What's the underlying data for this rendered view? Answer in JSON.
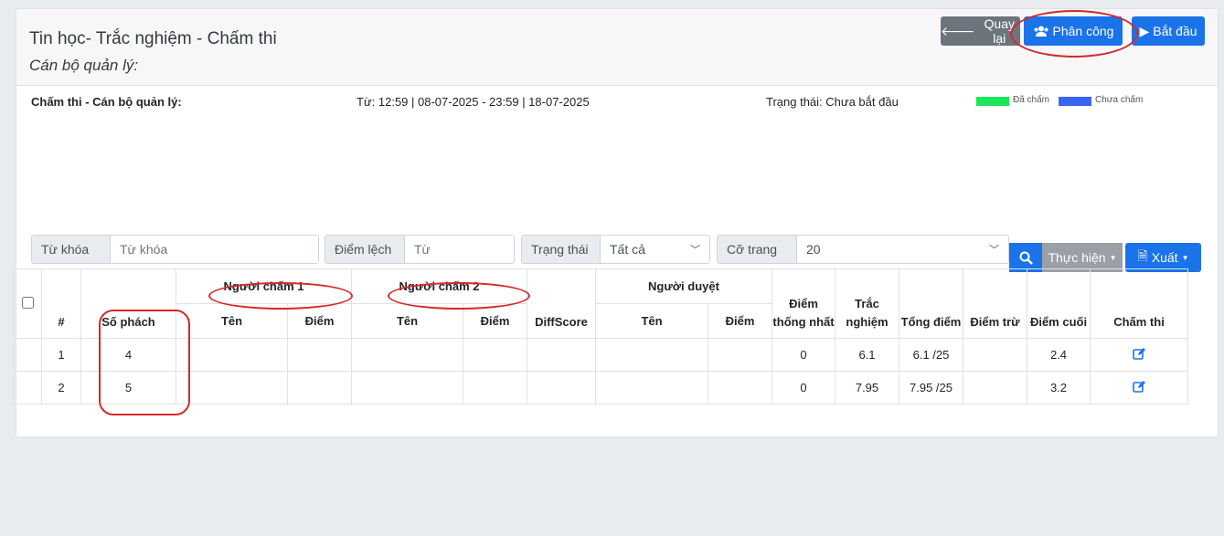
{
  "header": {
    "title": "Tin học- Trắc nghiệm - Chấm thi",
    "subtitle": "Cán bộ quản lý:",
    "back_label": "Quay lại",
    "assign_label": "Phân công",
    "start_label": "Bắt đầu"
  },
  "info": {
    "role_label": "Chấm thi - Cán bộ quản lý:",
    "time_range": "Từ: 12:59 | 08-07-2025 - 23:59 | 18-07-2025",
    "status": "Trạng thái: Chưa bắt đầu",
    "legend": [
      {
        "label": "Đã chấm",
        "color": "#1de55a"
      },
      {
        "label": "Chưa chấm",
        "color": "#3a63f0"
      }
    ]
  },
  "filters": {
    "keyword_label": "Từ khóa",
    "keyword_placeholder": "Từ khóa",
    "deviation_label": "Điểm lệch",
    "deviation_placeholder": "Từ",
    "status_label": "Trạng thái",
    "status_value": "Tất cả",
    "pagesize_label": "Cỡ trang",
    "pagesize_value": "20",
    "action_label": "Thực hiện",
    "export_label": "Xuất"
  },
  "table": {
    "headers": {
      "index": "#",
      "so_phach": "Số phách",
      "grader1": "Người chấm 1",
      "grader2": "Người chấm 2",
      "diffscore": "DiffScore",
      "approver": "Người duyệt",
      "name": "Tên",
      "score": "Điểm",
      "unified": "Điểm thống nhất",
      "mcq": "Trắc nghiệm",
      "total": "Tổng điểm",
      "deduct": "Điểm trừ",
      "final": "Điểm cuối",
      "grade": "Chấm thi"
    },
    "rows": [
      {
        "index": "1",
        "so_phach": "4",
        "unified": "0",
        "mcq": "6.1",
        "total": "6.1 /25",
        "final": "2.4"
      },
      {
        "index": "2",
        "so_phach": "5",
        "unified": "0",
        "mcq": "7.95",
        "total": "7.95 /25",
        "final": "3.2"
      }
    ]
  }
}
